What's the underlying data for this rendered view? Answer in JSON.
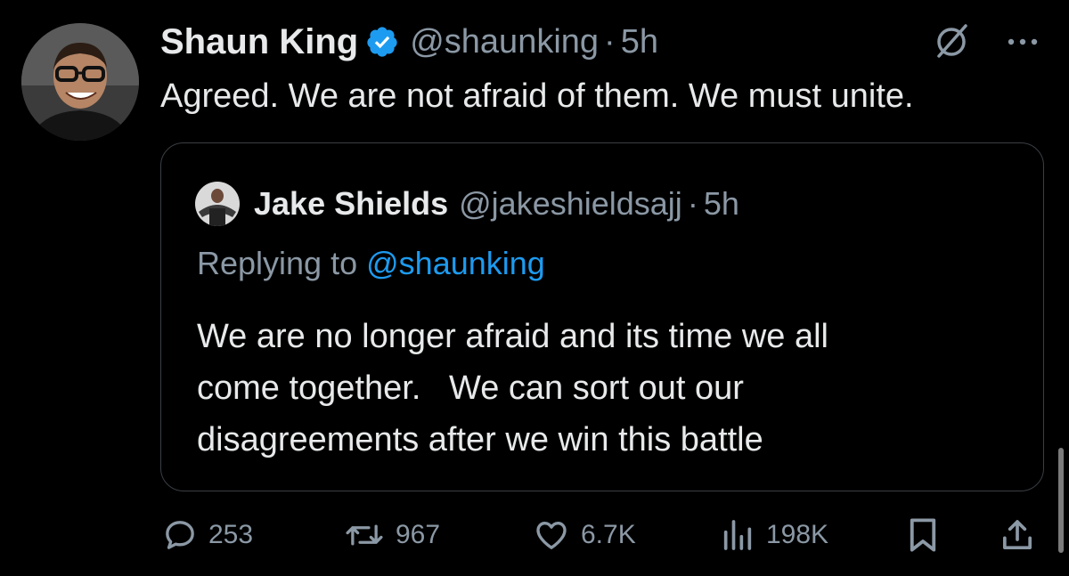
{
  "tweet": {
    "author_name": "Shaun King",
    "handle": "@shaunking",
    "separator": "·",
    "time": "5h",
    "text": "Agreed. We are not afraid of them. We must unite."
  },
  "quoted_tweet": {
    "author_name": "Jake Shields",
    "handle": "@jakeshieldsajj",
    "separator": "·",
    "time": "5h",
    "replying_prefix": "Replying to",
    "replying_to": "@shaunking",
    "text": "We are no longer afraid and its time we all\ncome together.   We can sort out our\ndisagreements after we win this battle"
  },
  "actions": {
    "replies": "253",
    "reposts": "967",
    "likes": "6.7K",
    "views": "198K"
  },
  "icons": {
    "verified": "verified-badge-icon",
    "no_notifications": "slashed-circle-icon",
    "more": "more-horizontal-icon",
    "reply": "reply-icon",
    "repost": "repost-icon",
    "like": "heart-icon",
    "views": "views-chart-icon",
    "bookmark": "bookmark-icon",
    "share": "share-icon"
  },
  "colors": {
    "background": "#000000",
    "text": "#e7e9ea",
    "secondary": "#8b98a5",
    "link": "#1d9bf0",
    "verified": "#1d9bf0",
    "border": "#3a3f44"
  }
}
